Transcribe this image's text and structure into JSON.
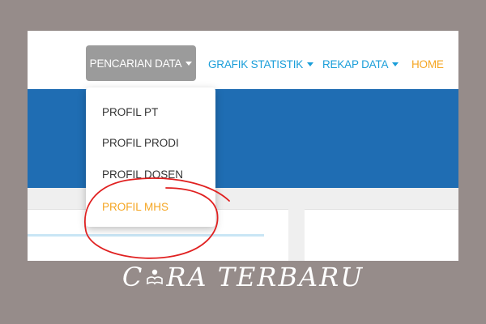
{
  "nav": {
    "items": [
      {
        "label": "PENCARIAN DATA",
        "active": true
      },
      {
        "label": "GRAFIK STATISTIK"
      },
      {
        "label": "REKAP DATA"
      },
      {
        "label": "HOME"
      }
    ]
  },
  "dropdown": {
    "items": [
      {
        "label": "PROFIL PT"
      },
      {
        "label": "PROFIL PRODI"
      },
      {
        "label": "PROFIL DOSEN"
      },
      {
        "label": "PROFIL MHS",
        "highlighted": true
      }
    ]
  },
  "caption": {
    "before_icon": "C",
    "after_icon": "RA TERBARU"
  },
  "colors": {
    "link": "#1a9ed9",
    "home": "#f5a623",
    "band": "#1f6db3",
    "annotation": "#e02020"
  },
  "icons": [
    "chevron-down-icon",
    "reading-person-icon"
  ]
}
